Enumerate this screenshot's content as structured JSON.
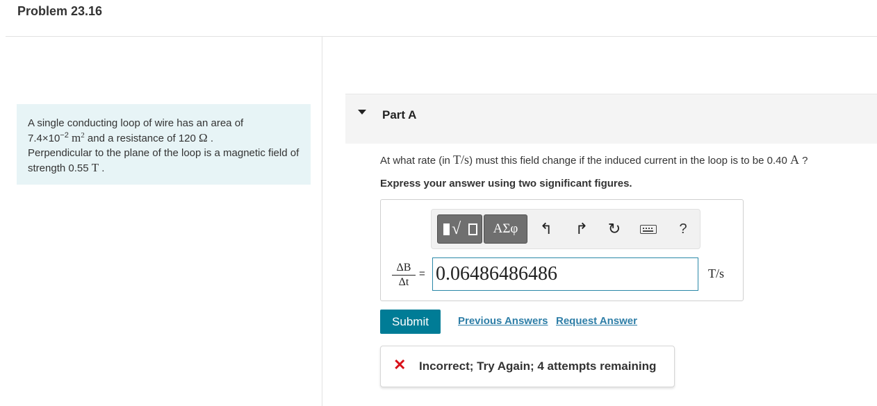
{
  "problem": {
    "title": "Problem 23.16",
    "text_1": "A single conducting loop of wire has an area of",
    "area_base": "7.4×10",
    "area_exp": "−2",
    "area_unit": "m",
    "area_unit_exp": "2",
    "text_2": " and a resistance of 120 ",
    "ohm": "Ω",
    "text_3": "Perpendicular to the plane of the loop is a magnetic field of strength 0.55 ",
    "tesla": "T"
  },
  "part": {
    "title": "Part A",
    "question_pre": "At what rate (in ",
    "question_unit": "T/s",
    "question_mid": ") must this field change if the induced current in the loop is to be 0.40 ",
    "question_amp": "A",
    "question_post": " ?",
    "instruction": "Express your answer using two significant figures."
  },
  "toolbar": {
    "greek_label": "ΑΣφ",
    "undo_glyph": "↰",
    "redo_glyph": "↱",
    "reset_glyph": "↻",
    "help_label": "?"
  },
  "answer": {
    "lhs_numerator": "ΔB",
    "lhs_denominator": "Δt",
    "equals": "=",
    "value": "0.06486486486",
    "units": "T/s"
  },
  "actions": {
    "submit_label": "Submit",
    "previous_answers_label": "Previous Answers",
    "request_answer_label": "Request Answer"
  },
  "feedback": {
    "icon": "✕",
    "message": "Incorrect; Try Again; 4 attempts remaining",
    "color": "#d9111a"
  }
}
